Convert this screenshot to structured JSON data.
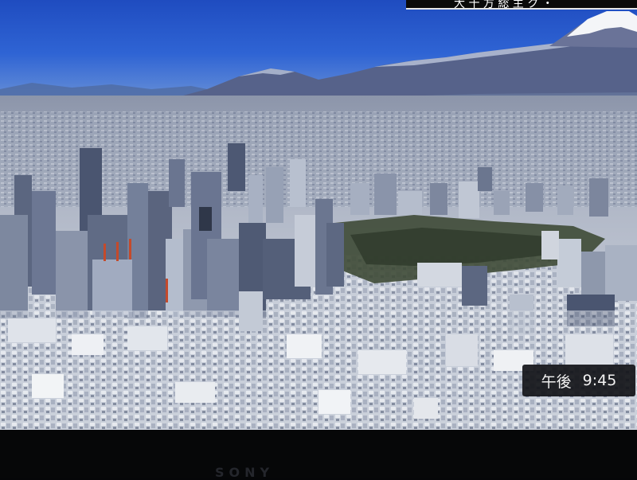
{
  "overlay": {
    "top_banner_text": "大 十 方 総 主 ク ・",
    "clock_period": "午後",
    "clock_time": "9:45"
  },
  "device": {
    "brand": "SONY"
  },
  "colors": {
    "sky": "#2a5cc9",
    "mountain": "#53618a",
    "city_light": "#d8dde6",
    "overlay_bg": "#121418"
  },
  "scene": {
    "description_icon": "mount-fuji-icon"
  }
}
